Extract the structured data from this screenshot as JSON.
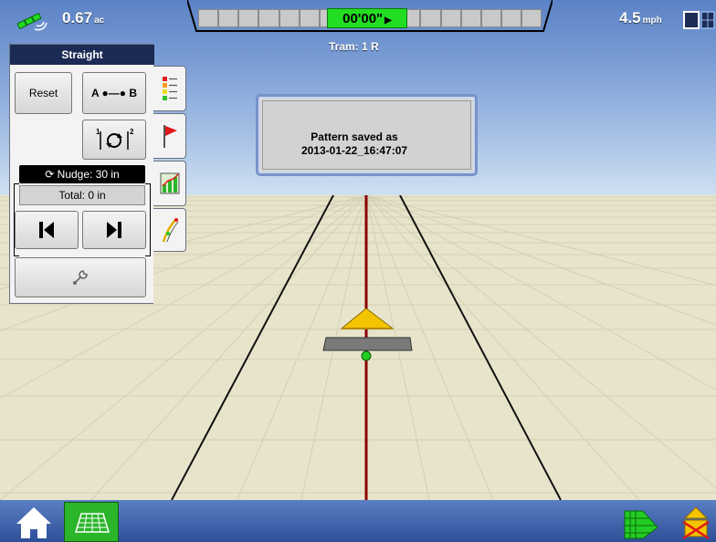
{
  "top": {
    "area_value": "0.67",
    "area_unit": "ac",
    "speed_value": "4.5",
    "speed_unit": "mph",
    "lightbar_time": "00'00\"",
    "tram": "Tram: 1 R"
  },
  "panel": {
    "title": "Straight",
    "reset_label": "Reset",
    "ab_label": "A ●—● B",
    "nudge_label": "Nudge: 30 in",
    "total_label": "Total: 0 in"
  },
  "popup": {
    "line1": "Pattern saved as",
    "line2": "2013-01-22_16:47:07"
  },
  "colors": {
    "sky_top": "#5b82c6",
    "ground": "#e8e4cc",
    "guidance_line": "#8b0000",
    "lightbar_center": "#22dd22",
    "bottom_bar": "#2d4f98",
    "panel_title_bg": "#1c2b55"
  },
  "icons": {
    "gps": "gps-satellite-icon",
    "view": "view-toggle-icon",
    "home": "home-icon",
    "map": "field-map-icon",
    "coverage": "coverage-icon",
    "master": "master-switch-icon"
  }
}
